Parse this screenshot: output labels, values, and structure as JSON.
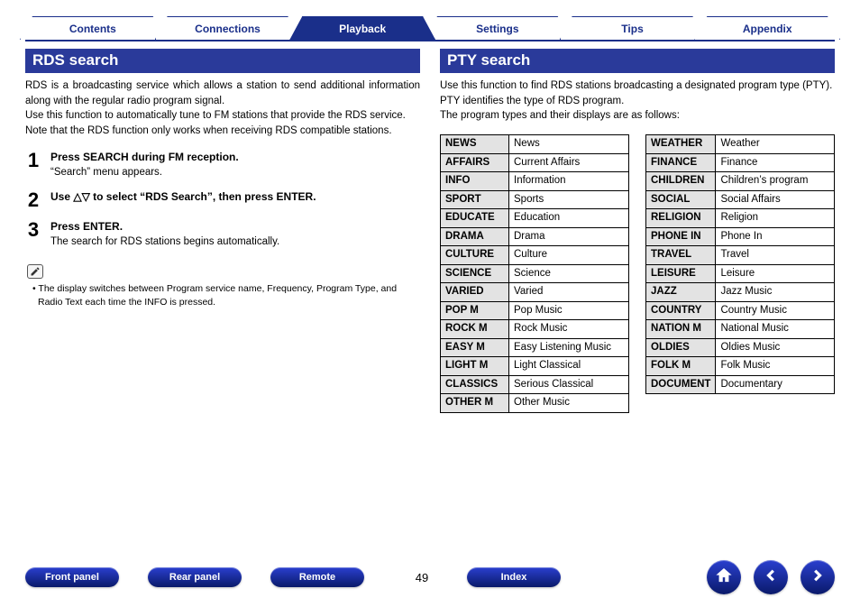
{
  "tabs": {
    "items": [
      {
        "label": "Contents",
        "active": false
      },
      {
        "label": "Connections",
        "active": false
      },
      {
        "label": "Playback",
        "active": true
      },
      {
        "label": "Settings",
        "active": false
      },
      {
        "label": "Tips",
        "active": false
      },
      {
        "label": "Appendix",
        "active": false
      }
    ]
  },
  "left": {
    "title": "RDS search",
    "intro": "RDS is a broadcasting service which allows a station to send additional information along with the regular radio program signal.\nUse this function to automatically tune to FM stations that provide the RDS service.\nNote that the RDS function only works when receiving RDS compatible stations.",
    "steps": [
      {
        "num": "1",
        "title": "Press SEARCH during FM reception.",
        "caption": "“Search” menu appears."
      },
      {
        "num": "2",
        "title": "Use △▽ to select “RDS Search”, then press ENTER.",
        "caption": ""
      },
      {
        "num": "3",
        "title": "Press ENTER.",
        "caption": "The search for RDS stations begins automatically."
      }
    ],
    "note_bullet": "•",
    "note": "The display switches between Program service name, Frequency, Program Type, and Radio Text each time the INFO is pressed."
  },
  "right": {
    "title": "PTY search",
    "intro": "Use this function to find RDS stations broadcasting a designated program type (PTY).\nPTY identifies the type of RDS program.\nThe program types and their displays are as follows:",
    "table_left": [
      {
        "code": "NEWS",
        "label": "News"
      },
      {
        "code": "AFFAIRS",
        "label": "Current Affairs"
      },
      {
        "code": "INFO",
        "label": "Information"
      },
      {
        "code": "SPORT",
        "label": "Sports"
      },
      {
        "code": "EDUCATE",
        "label": "Education"
      },
      {
        "code": "DRAMA",
        "label": "Drama"
      },
      {
        "code": "CULTURE",
        "label": "Culture"
      },
      {
        "code": "SCIENCE",
        "label": "Science"
      },
      {
        "code": "VARIED",
        "label": "Varied"
      },
      {
        "code": "POP M",
        "label": "Pop Music"
      },
      {
        "code": "ROCK M",
        "label": "Rock Music"
      },
      {
        "code": "EASY M",
        "label": "Easy Listening Music"
      },
      {
        "code": "LIGHT M",
        "label": "Light Classical"
      },
      {
        "code": "CLASSICS",
        "label": "Serious Classical"
      },
      {
        "code": "OTHER M",
        "label": "Other Music"
      }
    ],
    "table_right": [
      {
        "code": "WEATHER",
        "label": "Weather"
      },
      {
        "code": "FINANCE",
        "label": "Finance"
      },
      {
        "code": "CHILDREN",
        "label": "Children’s program"
      },
      {
        "code": "SOCIAL",
        "label": "Social Affairs"
      },
      {
        "code": "RELIGION",
        "label": "Religion"
      },
      {
        "code": "PHONE IN",
        "label": "Phone In"
      },
      {
        "code": "TRAVEL",
        "label": "Travel"
      },
      {
        "code": "LEISURE",
        "label": "Leisure"
      },
      {
        "code": "JAZZ",
        "label": "Jazz Music"
      },
      {
        "code": "COUNTRY",
        "label": "Country Music"
      },
      {
        "code": "NATION M",
        "label": "National Music"
      },
      {
        "code": "OLDIES",
        "label": "Oldies Music"
      },
      {
        "code": "FOLK M",
        "label": "Folk Music"
      },
      {
        "code": "DOCUMENT",
        "label": "Documentary"
      }
    ]
  },
  "bottom": {
    "buttons": [
      "Front panel",
      "Rear panel",
      "Remote"
    ],
    "page": "49",
    "index_label": "Index",
    "icons": [
      "home-icon",
      "prev-icon",
      "next-icon"
    ]
  },
  "colors": {
    "brand_blue": "#1a2f8a",
    "header_blue": "#2a3a9a",
    "row_gray": "#e3e3e3"
  }
}
